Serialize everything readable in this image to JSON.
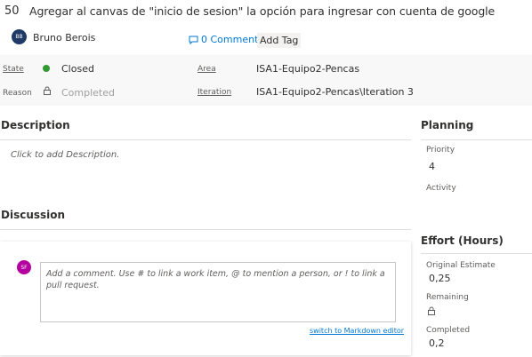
{
  "work_item": {
    "id": "50",
    "title": "Agregar al canvas de \"inicio de sesion\" la opción para ingresar con cuenta de google"
  },
  "author": {
    "initials": "BB",
    "name": "Bruno Berois"
  },
  "comments_label": "0 Comments",
  "add_tag_label": "Add Tag",
  "fields": {
    "state_label": "State",
    "state_value": "Closed",
    "reason_label": "Reason",
    "reason_value": "Completed",
    "area_label": "Area",
    "area_value": "ISA1-Equipo2-Pencas",
    "iteration_label": "Iteration",
    "iteration_value": "ISA1-Equipo2-Pencas\\Iteration 3"
  },
  "description": {
    "heading": "Description",
    "placeholder": "Click to add Description."
  },
  "discussion": {
    "heading": "Discussion",
    "user_initials": "SF",
    "comment_placeholder": "Add a comment. Use # to link a work item, @ to mention a person, or ! to link a pull request.",
    "markdown_link": "switch to Markdown editor"
  },
  "planning": {
    "heading": "Planning",
    "priority_label": "Priority",
    "priority_value": "4",
    "activity_label": "Activity"
  },
  "effort": {
    "heading": "Effort (Hours)",
    "original_label": "Original Estimate",
    "original_value": "0,25",
    "remaining_label": "Remaining",
    "completed_label": "Completed",
    "completed_value": "0,2"
  },
  "colors": {
    "state_closed": "#339933",
    "link": "#0078d4",
    "author_avatar": "#1f3a66",
    "user_avatar": "#b4009e"
  },
  "icons": [
    "comment-icon",
    "lock-icon",
    "state-dot-icon"
  ]
}
